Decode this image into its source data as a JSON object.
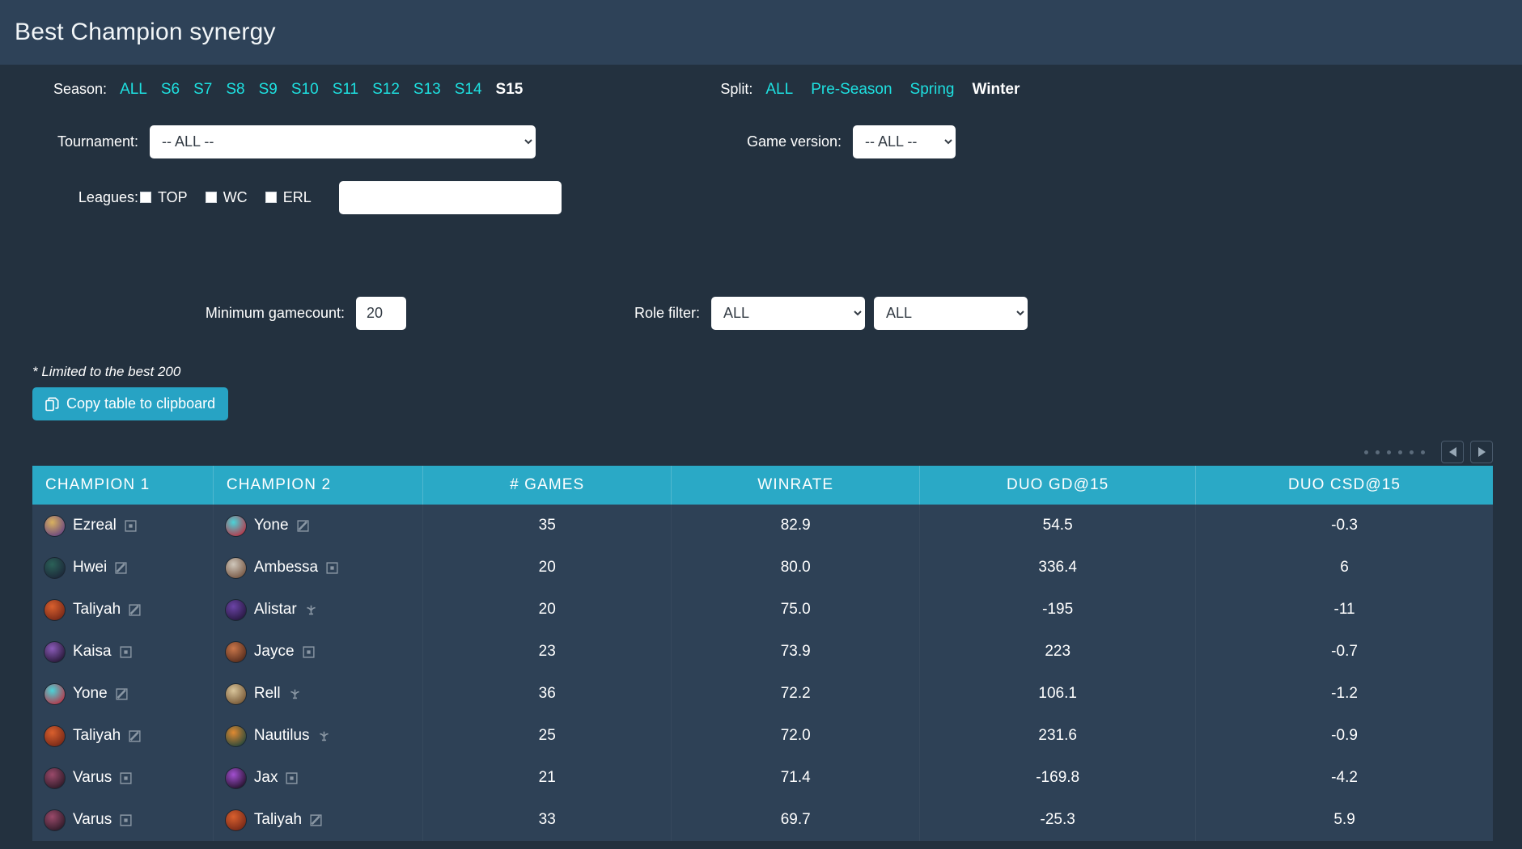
{
  "app": {
    "title": "Best Champion synergy",
    "accent": "#2aa9c6",
    "link_color": "#1ee0e0",
    "positive_color": "#2bd44a",
    "negative_color": "#e4656a"
  },
  "filters": {
    "season": {
      "label": "Season:",
      "options": [
        "ALL",
        "S6",
        "S7",
        "S8",
        "S9",
        "S10",
        "S11",
        "S12",
        "S13",
        "S14",
        "S15"
      ],
      "active": "S15"
    },
    "split": {
      "label": "Split:",
      "options": [
        "ALL",
        "Pre-Season",
        "Spring",
        "Winter"
      ],
      "active": "Winter"
    },
    "tournament": {
      "label": "Tournament:",
      "value": "-- ALL --",
      "options": [
        "-- ALL --"
      ]
    },
    "game_version": {
      "label": "Game version:",
      "value": "-- ALL --",
      "options": [
        "-- ALL --"
      ]
    },
    "leagues": {
      "label": "Leagues:",
      "checkboxes": [
        {
          "label": "TOP",
          "checked": false
        },
        {
          "label": "WC",
          "checked": false
        },
        {
          "label": "ERL",
          "checked": false
        }
      ],
      "text_value": "",
      "text_placeholder": ""
    },
    "minimum_gamecount": {
      "label": "Minimum gamecount:",
      "value": "20"
    },
    "role_filter": {
      "label": "Role filter:",
      "value_1": "ALL",
      "value_2": "ALL",
      "options": [
        "ALL"
      ]
    }
  },
  "note": "* Limited to the best 200",
  "copy_button": {
    "label": "Copy table to clipboard",
    "icon": "copy-icon"
  },
  "pagination": {
    "dots": 6,
    "prev_label": "Previous page",
    "next_label": "Next page"
  },
  "table": {
    "columns": [
      "CHAMPION 1",
      "CHAMPION 2",
      "# GAMES",
      "WINRATE",
      "DUO GD@15",
      "DUO CSD@15"
    ],
    "rows": [
      {
        "champion1": {
          "name": "Ezreal",
          "role": "bot",
          "c1": "#d9b25f",
          "c2": "#6e4a7e"
        },
        "champion2": {
          "name": "Yone",
          "role": "mid",
          "c1": "#4ad3d8",
          "c2": "#b33c4e"
        },
        "games": "35",
        "winrate": "82.9",
        "winrate_sign": "pos",
        "gd15": "54.5",
        "gd15_sign": "pos",
        "csd15": "-0.3",
        "csd15_sign": "neg"
      },
      {
        "champion1": {
          "name": "Hwei",
          "role": "mid",
          "c1": "#2b6158",
          "c2": "#1d2a3a"
        },
        "champion2": {
          "name": "Ambessa",
          "role": "bot",
          "c1": "#cfc7bb",
          "c2": "#7a5c49"
        },
        "games": "20",
        "winrate": "80.0",
        "winrate_sign": "pos",
        "gd15": "336.4",
        "gd15_sign": "pos",
        "csd15": "6",
        "csd15_sign": "pos"
      },
      {
        "champion1": {
          "name": "Taliyah",
          "role": "mid",
          "c1": "#d9602e",
          "c2": "#7a2a18"
        },
        "champion2": {
          "name": "Alistar",
          "role": "support",
          "c1": "#6b44a6",
          "c2": "#2a1a45"
        },
        "games": "20",
        "winrate": "75.0",
        "winrate_sign": "pos",
        "gd15": "-195",
        "gd15_sign": "neg",
        "csd15": "-11",
        "csd15_sign": "neg"
      },
      {
        "champion1": {
          "name": "Kaisa",
          "role": "bot",
          "c1": "#8a5bb8",
          "c2": "#2b1b3c"
        },
        "champion2": {
          "name": "Jayce",
          "role": "bot",
          "c1": "#c9764a",
          "c2": "#5a2f1e"
        },
        "games": "23",
        "winrate": "73.9",
        "winrate_sign": "pos",
        "gd15": "223",
        "gd15_sign": "pos",
        "csd15": "-0.7",
        "csd15_sign": "neg"
      },
      {
        "champion1": {
          "name": "Yone",
          "role": "mid",
          "c1": "#4ad3d8",
          "c2": "#b33c4e"
        },
        "champion2": {
          "name": "Rell",
          "role": "support",
          "c1": "#d8c49a",
          "c2": "#7a5c3a"
        },
        "games": "36",
        "winrate": "72.2",
        "winrate_sign": "pos",
        "gd15": "106.1",
        "gd15_sign": "pos",
        "csd15": "-1.2",
        "csd15_sign": "neg"
      },
      {
        "champion1": {
          "name": "Taliyah",
          "role": "mid",
          "c1": "#d9602e",
          "c2": "#7a2a18"
        },
        "champion2": {
          "name": "Nautilus",
          "role": "support",
          "c1": "#e08a32",
          "c2": "#2f4a3a"
        },
        "games": "25",
        "winrate": "72.0",
        "winrate_sign": "pos",
        "gd15": "231.6",
        "gd15_sign": "pos",
        "csd15": "-0.9",
        "csd15_sign": "neg"
      },
      {
        "champion1": {
          "name": "Varus",
          "role": "bot",
          "c1": "#9a4a6a",
          "c2": "#331c2b"
        },
        "champion2": {
          "name": "Jax",
          "role": "bot",
          "c1": "#a24fd0",
          "c2": "#2a1533"
        },
        "games": "21",
        "winrate": "71.4",
        "winrate_sign": "pos",
        "gd15": "-169.8",
        "gd15_sign": "neg",
        "csd15": "-4.2",
        "csd15_sign": "neg"
      },
      {
        "champion1": {
          "name": "Varus",
          "role": "bot",
          "c1": "#9a4a6a",
          "c2": "#331c2b"
        },
        "champion2": {
          "name": "Taliyah",
          "role": "mid",
          "c1": "#d9602e",
          "c2": "#7a2a18"
        },
        "games": "33",
        "winrate": "69.7",
        "winrate_sign": "pos",
        "gd15": "-25.3",
        "gd15_sign": "neg",
        "csd15": "5.9",
        "csd15_sign": "pos"
      }
    ]
  }
}
